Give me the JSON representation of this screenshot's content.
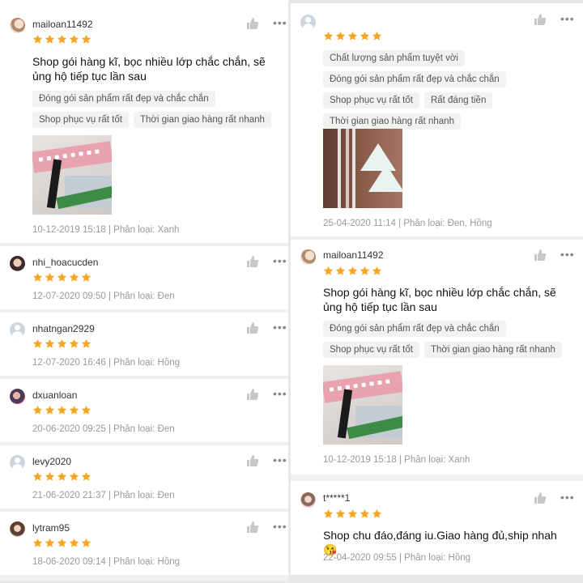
{
  "colors": {
    "star": "#f5a623",
    "accent": "#ee4d2d",
    "muted": "#999999"
  },
  "left_column": {
    "reviews": [
      {
        "username": "mailoan11492",
        "avatar": "photo",
        "rating": 5,
        "comment": "Shop gói hàng kĩ, bọc nhiều lớp chắc chắn, sẽ ủng hộ tiếp tục lần sau",
        "tags": [
          "Đóng gói sản phẩm rất đẹp và chắc chắn",
          "Shop phục vụ rất tốt",
          "Thời gian giao hàng rất nhanh"
        ],
        "meta": "10-12-2019 15:18 | Phân loại: Xanh"
      },
      {
        "username": "nhi_hoacucden",
        "avatar": "photo",
        "rating": 5,
        "meta": "12-07-2020 09:50 | Phân loại: Đen"
      },
      {
        "username": "nhatngan2929",
        "avatar": "default",
        "rating": 5,
        "meta": "12-07-2020 16:46 | Phân loại: Hồng"
      },
      {
        "username": "dxuanloan",
        "avatar": "photo",
        "rating": 5,
        "meta": "20-06-2020 09:25 | Phân loại: Đen"
      },
      {
        "username": "levy2020",
        "avatar": "default",
        "rating": 5,
        "meta": "21-06-2020 21:37 | Phân loại: Đen"
      },
      {
        "username": "lytram95",
        "avatar": "photo",
        "rating": 5,
        "meta": "18-06-2020 09:14 | Phân loại: Hồng"
      }
    ]
  },
  "right_column": {
    "reviews": [
      {
        "username": "",
        "avatar": "default",
        "rating": 5,
        "tags": [
          "Chất lượng sản phẩm tuyệt vời",
          "Đóng gói sản phẩm rất đẹp và chắc chắn",
          "Shop phục vụ rất tốt",
          "Rất đáng tiền",
          "Thời gian giao hàng rất nhanh"
        ],
        "meta": "25-04-2020 11:14 | Phân loại: Đen, Hồng"
      },
      {
        "username": "mailoan11492",
        "avatar": "photo",
        "rating": 5,
        "comment": "Shop gói hàng kĩ, bọc nhiều lớp chắc chắn, sẽ ủng hộ tiếp tục lần sau",
        "tags": [
          "Đóng gói sản phẩm rất đẹp và chắc chắn",
          "Shop phục vụ rất tốt",
          "Thời gian giao hàng rất nhanh"
        ],
        "meta": "10-12-2019 15:18 | Phân loại: Xanh"
      },
      {
        "username": "t*****1",
        "avatar": "photo",
        "rating": 5,
        "comment": "Shop chu đáo,đáng iu.Giao hàng đủ,ship nhah 😘",
        "meta": "22-04-2020 09:55 | Phân loại: Hồng"
      }
    ]
  },
  "icons": {
    "like": "thumbs-up-icon",
    "more": "more-options-icon",
    "star": "star-icon"
  }
}
